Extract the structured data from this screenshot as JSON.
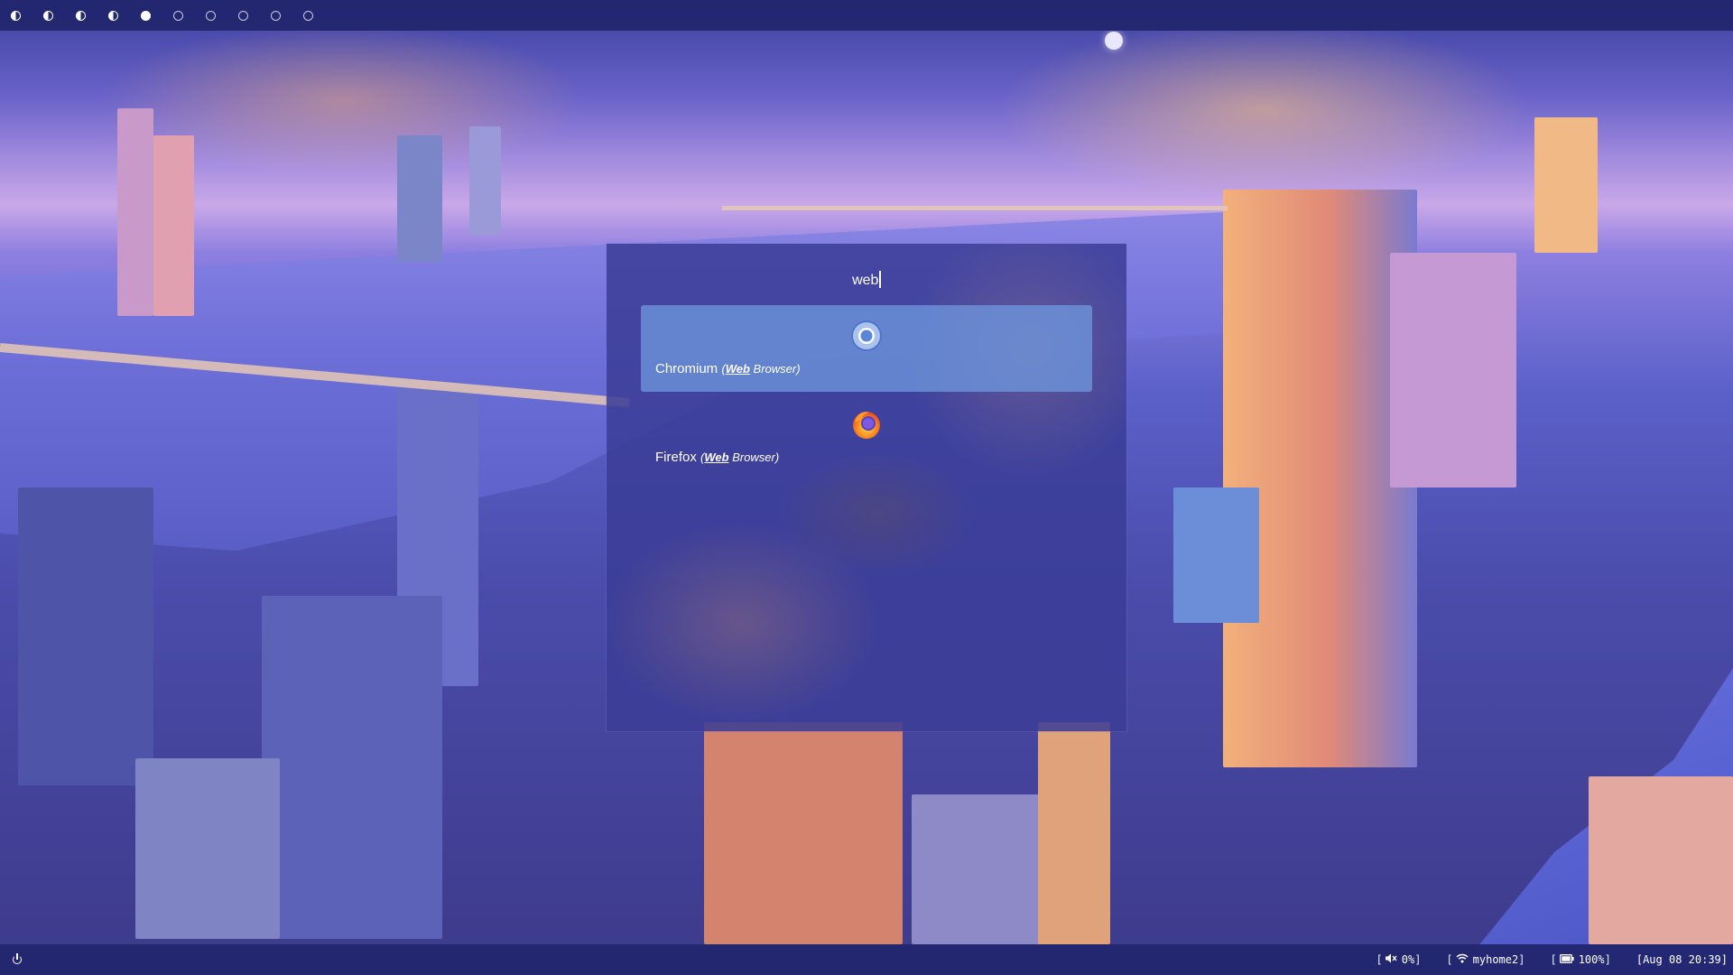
{
  "topbar": {
    "workspaces": [
      {
        "state": "occupied"
      },
      {
        "state": "occupied"
      },
      {
        "state": "occupied"
      },
      {
        "state": "occupied"
      },
      {
        "state": "active"
      },
      {
        "state": "empty"
      },
      {
        "state": "empty"
      },
      {
        "state": "empty"
      },
      {
        "state": "empty"
      },
      {
        "state": "empty"
      }
    ]
  },
  "launcher": {
    "query": "web",
    "results": [
      {
        "name": "Chromium",
        "open_paren": "(",
        "match": "Web",
        "category": " Browser",
        "close_paren": ")",
        "icon": "chromium-icon",
        "selected": true
      },
      {
        "name": "Firefox",
        "open_paren": "(",
        "match": "Web",
        "category": " Browser",
        "close_paren": ")",
        "icon": "firefox-icon",
        "selected": false
      }
    ]
  },
  "bottombar": {
    "power_icon": "power-icon",
    "volume": {
      "open": "[",
      "icon": "volume-muted-icon",
      "value": "0%",
      "close": "]"
    },
    "network": {
      "open": "[",
      "icon": "wifi-icon",
      "value": "myhome2",
      "close": "]"
    },
    "battery": {
      "open": "[",
      "icon": "battery-icon",
      "value": "100%",
      "close": "]"
    },
    "clock": {
      "value": "[Aug 08 20:39]"
    }
  },
  "colors": {
    "bar_bg": "#22266e",
    "launcher_bg": "#3a3c96",
    "selection_bg": "#6e96dc",
    "text": "#ffffff"
  }
}
